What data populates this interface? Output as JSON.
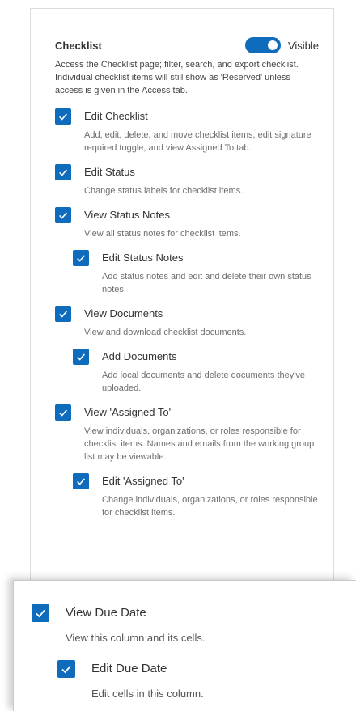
{
  "section": {
    "title": "Checklist",
    "toggle_label": "Visible",
    "toggle_on": true,
    "description": "Access the Checklist page; filter, search, and export checklist. Individual checklist items will still show as 'Reserved' unless access is given in the Access tab."
  },
  "permissions": [
    {
      "label": "Edit Checklist",
      "description": "Add, edit, delete, and move checklist items, edit signature required toggle, and view Assigned To tab.",
      "checked": true,
      "level": 0
    },
    {
      "label": "Edit Status",
      "description": "Change status labels for checklist items.",
      "checked": true,
      "level": 0
    },
    {
      "label": "View Status Notes",
      "description": "View all status notes for checklist items.",
      "checked": true,
      "level": 0
    },
    {
      "label": "Edit Status Notes",
      "description": "Add status notes and edit and delete their own status notes.",
      "checked": true,
      "level": 1
    },
    {
      "label": "View Documents",
      "description": "View and download checklist documents.",
      "checked": true,
      "level": 0
    },
    {
      "label": "Add Documents",
      "description": "Add local documents and delete documents they've uploaded.",
      "checked": true,
      "level": 1
    },
    {
      "label": "View 'Assigned To'",
      "description": "View individuals, organizations, or roles responsible for checklist items. Names and emails from the working group list may be viewable.",
      "checked": true,
      "level": 0
    },
    {
      "label": "Edit 'Assigned To'",
      "description": "Change individuals, organizations, or roles responsible for checklist items.",
      "checked": true,
      "level": 1
    }
  ],
  "zoomed": [
    {
      "label": "View Due Date",
      "description": "View this column and its cells.",
      "checked": true,
      "level": 0
    },
    {
      "label": "Edit Due Date",
      "description": "Edit cells in this column.",
      "checked": true,
      "level": 1
    }
  ],
  "colors": {
    "accent": "#0f6cbd",
    "text": "#333333",
    "muted": "#6e6e6e"
  }
}
